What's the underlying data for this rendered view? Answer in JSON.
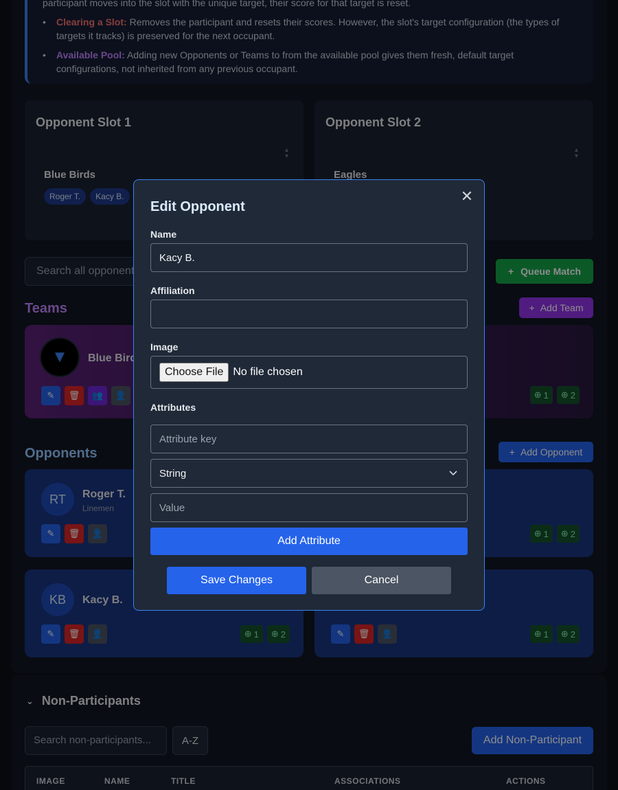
{
  "info": {
    "top_line": "participant moves into the slot with the unique target, their score for that target is reset.",
    "items": [
      {
        "label": "Clearing a Slot:",
        "text": " Removes the participant and resets their scores. However, the slot's target configuration (the types of targets it tracks) is preserved for the next occupant."
      },
      {
        "label": "Available Pool:",
        "text": " Adding new Opponents or Teams to from the available pool gives them fresh, default target configurations, not inherited from any previous occupant."
      }
    ]
  },
  "slots": [
    {
      "title": "Opponent Slot 1",
      "team": "Blue Birds",
      "members": [
        "Roger T.",
        "Kacy B."
      ]
    },
    {
      "title": "Opponent Slot 2",
      "team": "Eagles",
      "members": []
    }
  ],
  "toolbar": {
    "search_placeholder": "Search all opponents",
    "queue_label": "Queue Match"
  },
  "teams": {
    "title": "Teams",
    "add_label": "Add Team",
    "items": [
      {
        "name": "Blue Birds",
        "scores": [
          "1",
          "2"
        ]
      }
    ]
  },
  "opponents": {
    "title": "Opponents",
    "add_label": "Add Opponent",
    "items": [
      {
        "initials": "RT",
        "name": "Roger T.",
        "sub": "Linemen",
        "scores": [
          "1",
          "2"
        ]
      },
      {
        "initials": "KB",
        "name": "Kacy B.",
        "sub": "",
        "scores": [
          "1",
          "2"
        ]
      }
    ],
    "right_scores": [
      [
        "1",
        "2"
      ],
      [
        "1",
        "2"
      ]
    ]
  },
  "non_participants": {
    "title": "Non-Participants",
    "search_placeholder": "Search non-participants...",
    "sort_label": "A-Z",
    "add_label": "Add Non-Participant",
    "columns": [
      "IMAGE",
      "NAME",
      "TITLE",
      "ASSOCIATIONS",
      "ACTIONS"
    ]
  },
  "modal": {
    "title": "Edit Opponent",
    "name_label": "Name",
    "name_value": "Kacy B.",
    "affiliation_label": "Affiliation",
    "affiliation_value": "",
    "image_label": "Image",
    "file_button": "Choose File",
    "file_status": "No file chosen",
    "attributes_label": "Attributes",
    "attr_key_placeholder": "Attribute key",
    "attr_type": "String",
    "attr_value_placeholder": "Value",
    "add_attribute_label": "Add Attribute",
    "save_label": "Save Changes",
    "cancel_label": "Cancel"
  },
  "colors": {
    "accent": "#2563eb",
    "modal_border": "#3b82f6",
    "team_btn": "#9333ea",
    "queue_btn": "#16a34a"
  }
}
